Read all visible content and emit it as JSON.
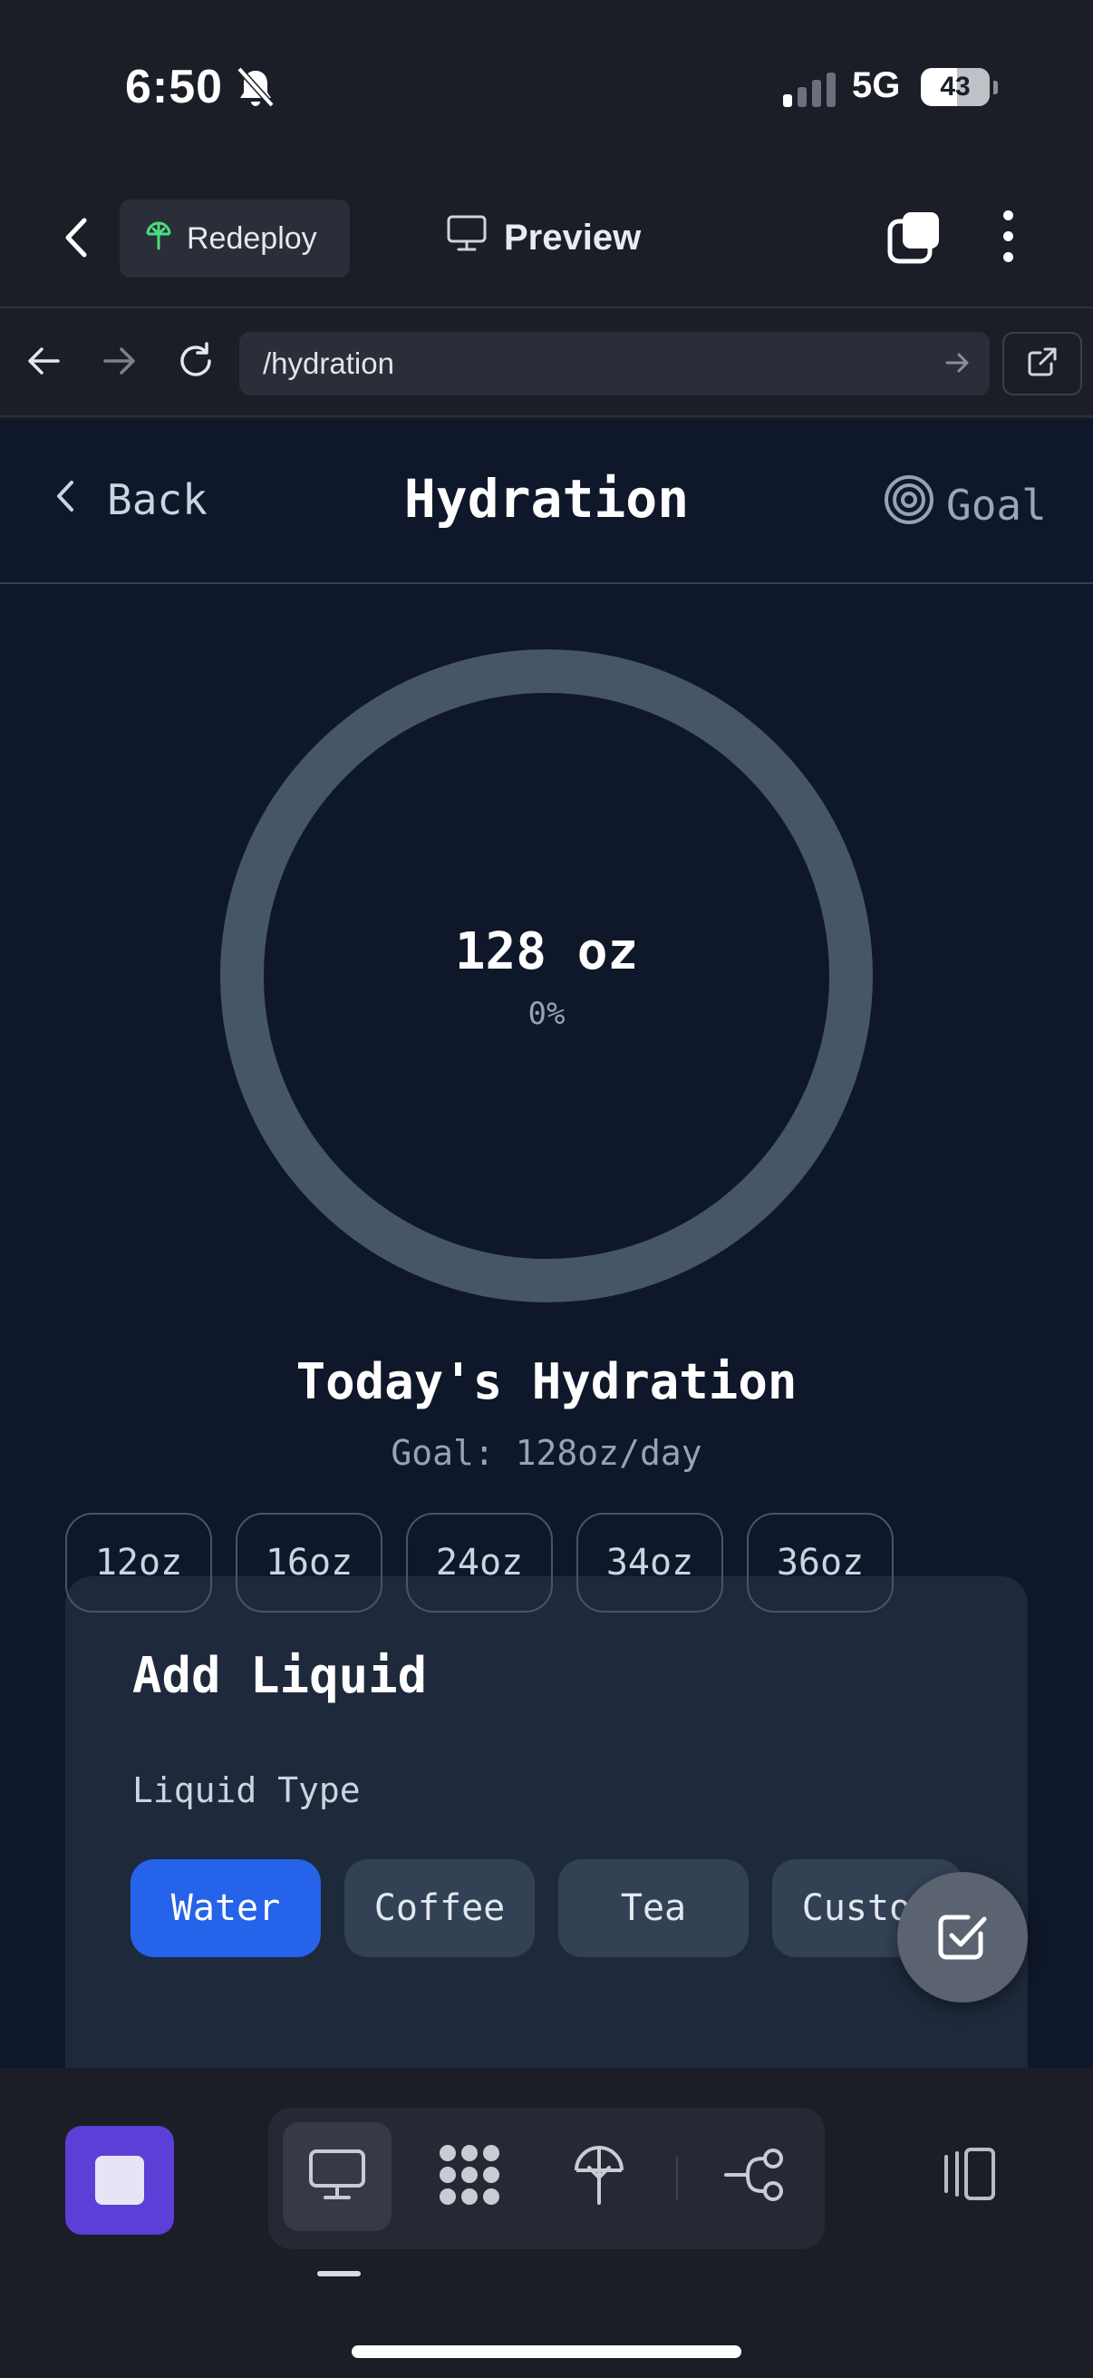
{
  "status_bar": {
    "time": "6:50",
    "network": "5G",
    "battery": "43"
  },
  "toolbar": {
    "redeploy_label": "Redeploy",
    "preview_label": "Preview"
  },
  "browser": {
    "url": "/hydration"
  },
  "page": {
    "back_label": "Back",
    "title": "Hydration",
    "goal_label": "Goal",
    "progress": {
      "amount": "128 oz",
      "percent": "0%",
      "fraction": 0
    },
    "today_title": "Today's Hydration",
    "today_goal": "Goal: 128oz/day",
    "add_card": {
      "title": "Add Liquid",
      "type_label": "Liquid Type",
      "types": [
        "Water",
        "Coffee",
        "Tea",
        "Custom"
      ],
      "selected_type": "Water",
      "sizes": [
        "12oz",
        "16oz",
        "24oz",
        "34oz",
        "36oz"
      ]
    }
  },
  "colors": {
    "accent": "#2563eb",
    "ring": "#475569",
    "background": "#0f172a",
    "stop_button": "#5b3fd6"
  },
  "icons": {
    "toolbar": [
      "chevron-left-icon",
      "redeploy-icon",
      "monitor-icon",
      "tabs-icon",
      "more-vertical-icon"
    ],
    "browser": [
      "arrow-left-icon",
      "arrow-right-icon",
      "reload-icon",
      "arrow-go-icon",
      "external-link-icon"
    ],
    "page": [
      "chevron-left-icon",
      "target-icon",
      "checkbox-icon"
    ],
    "bottom": [
      "stop-icon",
      "monitor-icon",
      "apps-icon",
      "deploy-icon",
      "workflow-icon",
      "panel-icon"
    ]
  }
}
